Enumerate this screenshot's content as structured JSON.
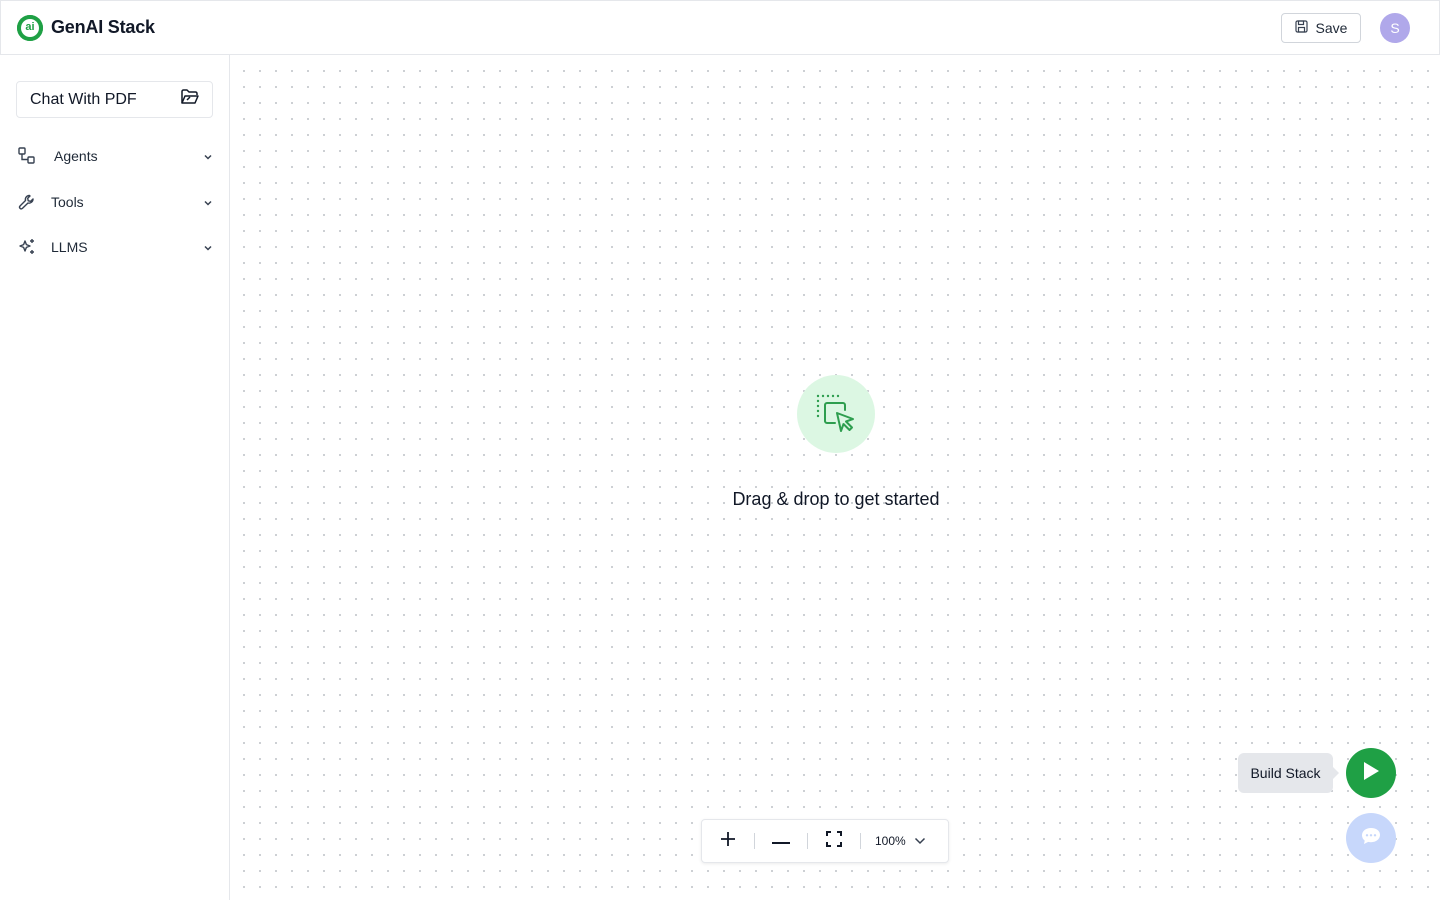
{
  "header": {
    "logo_text": "ai",
    "title": "GenAI Stack",
    "save_label": "Save",
    "avatar_initial": "S"
  },
  "sidebar": {
    "stack_name": "Chat With PDF",
    "items": [
      {
        "label": "Agents",
        "icon": "agents-icon"
      },
      {
        "label": "Tools",
        "icon": "wrench-icon"
      },
      {
        "label": "LLMS",
        "icon": "sparkles-icon"
      }
    ]
  },
  "canvas": {
    "empty_message": "Drag & drop to get started"
  },
  "zoom": {
    "level": "100%"
  },
  "build": {
    "tooltip": "Build Stack"
  },
  "colors": {
    "brand_green": "#1fa045",
    "avatar": "#b0a8ea",
    "chat_button": "#c7d7fb",
    "empty_state_bg": "#dcf7e3"
  }
}
